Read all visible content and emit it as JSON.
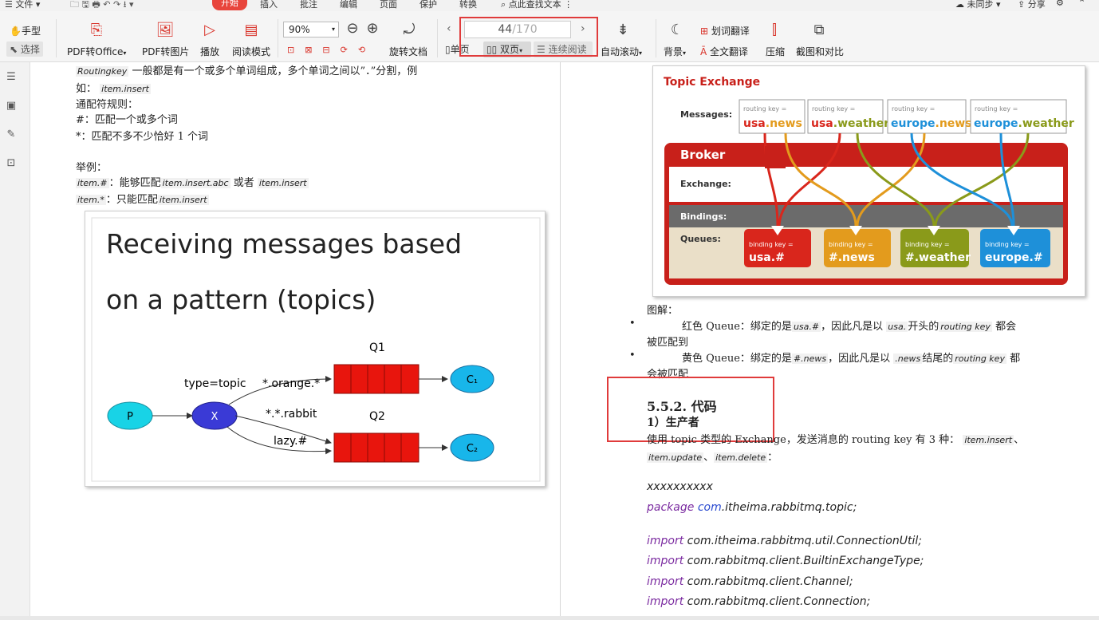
{
  "menubar": {
    "file": "文件",
    "start": "开始",
    "tabs": [
      "插入",
      "批注",
      "编辑",
      "页面",
      "保护",
      "转换"
    ],
    "find": "点此查找文本",
    "sync": "未同步",
    "share": "分享"
  },
  "toolbar": {
    "hand": "手型",
    "select": "选择",
    "pdf_office": "PDF转Office",
    "pdf_image": "PDF转图片",
    "play": "播放",
    "read_mode": "阅读模式",
    "zoom": "90%",
    "rotate": "旋转文档",
    "page_current": "44",
    "page_total": "/170",
    "single": "单页",
    "double": "双页",
    "continuous": "连续阅读",
    "auto_scroll": "自动滚动",
    "background": "背景",
    "word_translate": "划词翻译",
    "full_translate": "全文翻译",
    "compress": "压缩",
    "screenshot": "截图和对比"
  },
  "left_page": {
    "line1_code": "Routingkey",
    "line1_text": " 一般都是有一个或多个单词组成，多个单词之间以”．”分割，例",
    "line2_pre": "如：",
    "line2_code": "item.insert",
    "rules_title": "通配符规则：",
    "rule1": "#：匹配一个或多个词",
    "rule2": "*：匹配不多不少恰好 1 个词",
    "example_title": "举例：",
    "ex1_code": "item.#",
    "ex1_text": "：能够匹配",
    "ex1_code2": "item.insert.abc",
    "ex1_or": " 或者 ",
    "ex1_code3": "item.insert",
    "ex2_code": "item.*",
    "ex2_text": "：只能匹配",
    "ex2_code2": "item.insert",
    "figure": {
      "title_line1": "Receiving messages based",
      "title_line2": "on a pattern (topics)",
      "p": "P",
      "x": "X",
      "type_label": "type=topic",
      "q1": "Q1",
      "q2": "Q2",
      "binding1": "*.orange.*",
      "binding2": "*.*.rabbit",
      "binding3": "lazy.#",
      "c1": "C₁",
      "c2": "C₂"
    }
  },
  "right_page": {
    "figure": {
      "title": "Topic Exchange",
      "messages": "Messages:",
      "routing_key": "routing key =",
      "msgs": [
        {
          "a": "usa",
          "b": ".news"
        },
        {
          "a": "usa",
          "b": ".weather"
        },
        {
          "a": "europe",
          "b": ".news"
        },
        {
          "a": "europe",
          "b": ".weather"
        }
      ],
      "broker": "Broker",
      "exchange": "Exchange:",
      "bindings": "Bindings:",
      "queues": "Queues:",
      "binding_key": "binding key =",
      "queue_keys": [
        "usa.#",
        "#.news",
        "#.weather",
        "europe.#"
      ],
      "colors": {
        "red": "#d9261c",
        "yellow": "#e39b1d",
        "olive": "#8a9a1a",
        "blue": "#1e90d9"
      }
    },
    "caption": "图解：",
    "b1_pre": "红色 Queue：绑定的是",
    "b1_code": "usa.#",
    "b1_mid": "，因此凡是以",
    "b1_code2": "usa.",
    "b1_mid2": "开头的",
    "b1_code3": "routing key",
    "b1_end": "都会",
    "b1_line2": "被匹配到",
    "b2_pre": "黄色 Queue：绑定的是",
    "b2_code": "#.news",
    "b2_mid": "，因此凡是以",
    "b2_code2": ".news",
    "b2_mid2": "结尾的",
    "b2_code3": "routing key",
    "b2_end": "都",
    "b2_line2": "会被匹配",
    "section": "5.5.2. 代码",
    "subsection": "1）生产者",
    "desc": "使用 topic 类型的 Exchange，发送消息的 routing key 有 3 种：",
    "desc_code1": "item.insert",
    "desc_code2": "item.update",
    "desc_code3": "item.delete",
    "xx": "xxxxxxxxxx",
    "code_lines": [
      {
        "kw": "package",
        "rest": "com",
        "rest2": ".itheima.rabbitmq.topic;"
      },
      {
        "kw": "import",
        "rest": " com.itheima.rabbitmq.util.ConnectionUtil;"
      },
      {
        "kw": "import",
        "rest": " com.rabbitmq.client.BuiltinExchangeType;"
      },
      {
        "kw": "import",
        "rest": " com.rabbitmq.client.Channel;"
      },
      {
        "kw": "import",
        "rest": " com.rabbitmq.client.Connection;"
      }
    ]
  }
}
